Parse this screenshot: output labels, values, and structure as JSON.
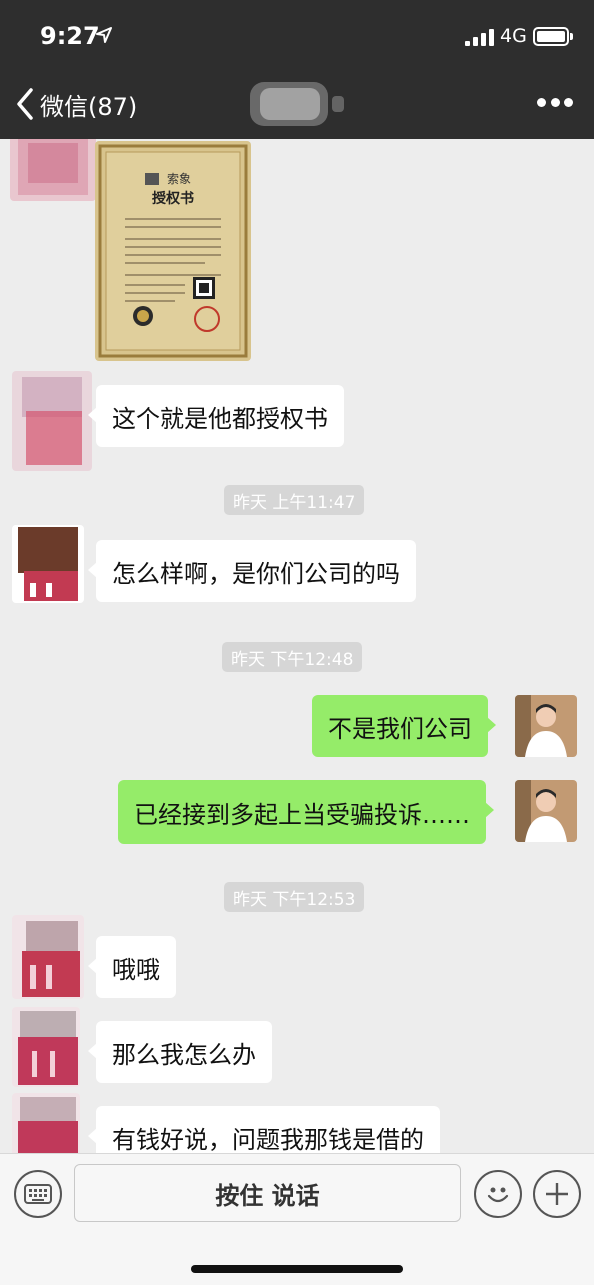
{
  "status_bar": {
    "time": "9:27",
    "network": "4G"
  },
  "nav": {
    "back_label": "微信(87)"
  },
  "messages": [
    {
      "type": "text",
      "direction": "in",
      "text": "这个就是他都授权书"
    },
    {
      "type": "timestamp",
      "text": "昨天 上午11:47"
    },
    {
      "type": "text",
      "direction": "in",
      "text": "怎么样啊，是你们公司的吗"
    },
    {
      "type": "timestamp",
      "text": "昨天 下午12:48"
    },
    {
      "type": "text",
      "direction": "out",
      "text": "不是我们公司"
    },
    {
      "type": "text",
      "direction": "out",
      "text": "已经接到多起上当受骗投诉……"
    },
    {
      "type": "timestamp",
      "text": "昨天 下午12:53"
    },
    {
      "type": "text",
      "direction": "in",
      "text": "哦哦"
    },
    {
      "type": "text",
      "direction": "in",
      "text": "那么我怎么办"
    },
    {
      "type": "text",
      "direction": "in",
      "text": "有钱好说，问题我那钱是借的"
    }
  ],
  "certificate": {
    "brand": "索象",
    "title": "授权书"
  },
  "input_bar": {
    "hold_to_talk_label": "按住 说话"
  },
  "icons": {
    "back": "chevron-left-icon",
    "more": "more-icon",
    "keyboard": "keyboard-icon",
    "emoji": "emoji-icon",
    "plus": "plus-icon"
  },
  "colors": {
    "header_bg": "#2e2e2e",
    "chat_bg": "#ededed",
    "out_bubble": "#95ec69",
    "in_bubble": "#ffffff"
  }
}
